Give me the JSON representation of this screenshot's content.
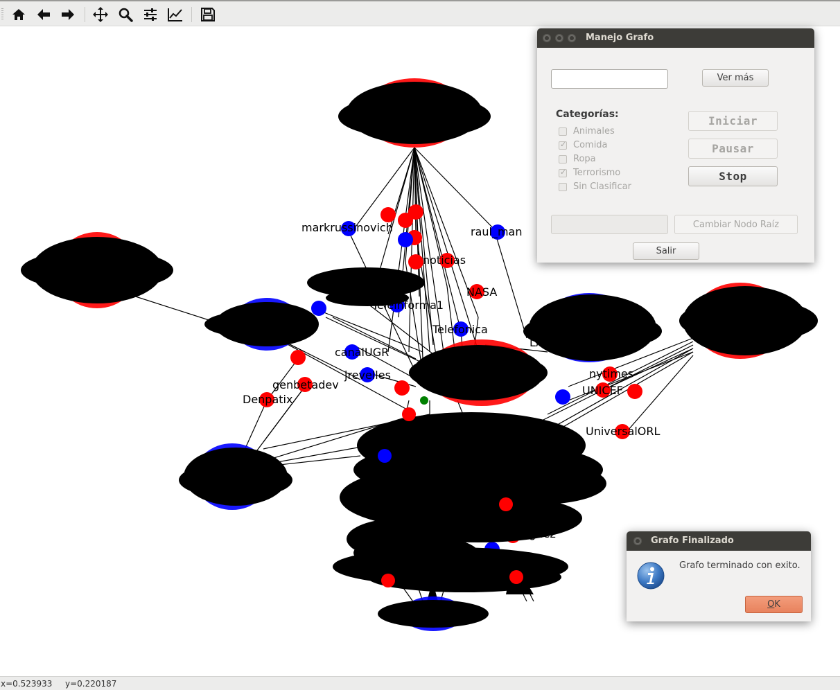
{
  "toolbar": {
    "buttons": [
      {
        "name": "home-icon"
      },
      {
        "name": "back-arrow-icon"
      },
      {
        "name": "forward-arrow-icon"
      },
      {
        "name": "pan-icon"
      },
      {
        "name": "zoom-icon"
      },
      {
        "name": "subplots-configure-icon"
      },
      {
        "name": "edit-axis-icon"
      },
      {
        "name": "save-icon"
      }
    ]
  },
  "graph": {
    "node_colors": {
      "red": "#ff0000",
      "blue": "#0000ff",
      "green": "#008000"
    },
    "labels": {
      "markrussinovich": "markrussinovich",
      "raulillan": "raul_man",
      "nytimes": "nytimes",
      "telefonica": "Telefonica",
      "nasa": "NASA",
      "genbetadev": "genbetadev",
      "jrevelles": "jrevelles",
      "universalorl": "UniversalORL",
      "noticias": "noticias",
      "denpatix": "Denpatix",
      "canalugr": "canalUGR",
      "unicef": "UNICEF",
      "lais": "LAIS",
      "teleinforma": "Teleinforma1",
      "rodriguez": "Rodriguez"
    }
  },
  "status": {
    "x": "x=0.523933",
    "y": "y=0.220187"
  },
  "manejo_dialog": {
    "title": "Manejo Grafo",
    "search_value": "",
    "ver_mas": "Ver más",
    "categorias_label": "Categorías:",
    "categories": [
      {
        "label": "Animales",
        "checked": false
      },
      {
        "label": "Comida",
        "checked": true
      },
      {
        "label": "Ropa",
        "checked": false
      },
      {
        "label": "Terrorismo",
        "checked": true
      },
      {
        "label": "Sin Clasificar",
        "checked": false
      }
    ],
    "iniciar": "Iniciar",
    "pausar": "Pausar",
    "stop": "Stop",
    "root_value": "",
    "cambiar_nodo": "Cambiar Nodo Raíz",
    "salir": "Salir"
  },
  "finalizado_dialog": {
    "title": "Grafo Finalizado",
    "message": "Grafo terminado con exito.",
    "ok_prefix": "O",
    "ok_rest": "K",
    "info_icon": "info-icon"
  }
}
